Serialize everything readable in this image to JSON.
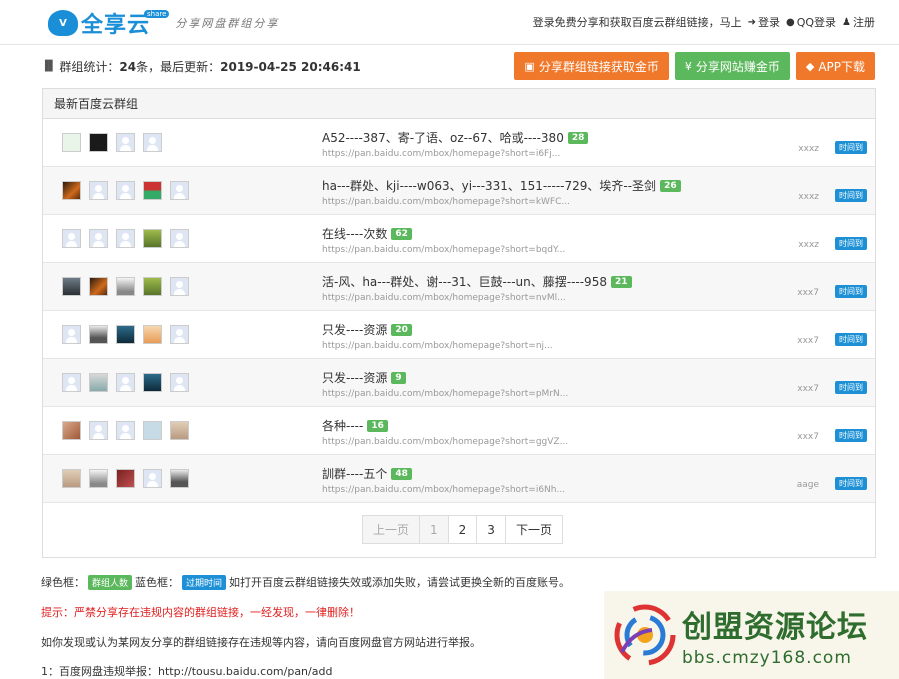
{
  "header": {
    "logo_mark": "V",
    "logo_name": "全享云",
    "logo_badge": "share",
    "slogan": "分享网盘群组分享",
    "nav_text": "登录免费分享和获取百度云群组链接，马上",
    "login": "登录",
    "qq_login": "QQ登录",
    "register": "注册"
  },
  "stats": {
    "label_prefix": "群组统计：",
    "count": "24",
    "label_mid": "条，最后更新：",
    "updated": "2019-04-25 20:46:41"
  },
  "actions": {
    "share_group": "分享群组链接获取金币",
    "share_site": "分享网站赚金币",
    "app_download": "APP下载"
  },
  "panel": {
    "title": "最新百度云群组",
    "rows": [
      {
        "title": "A52----387、寄-了语、oz--67、哈或----380",
        "count": "28",
        "link": "https://pan.baidu.com/mbox/homepage?short=i6Fj...",
        "user": "xxxz",
        "tag": "时间到"
      },
      {
        "title": "ha---群处、kji----w063、yi---331、151-----729、埃齐--圣剑",
        "count": "26",
        "link": "https://pan.baidu.com/mbox/homepage?short=kWFC...",
        "user": "xxxz",
        "tag": "时间到"
      },
      {
        "title": "在线----次数",
        "count": "62",
        "link": "https://pan.baidu.com/mbox/homepage?short=bqdY...",
        "user": "xxxz",
        "tag": "时间到"
      },
      {
        "title": "活-风、ha---群处、谢---31、巨鼓---un、藤摆----958",
        "count": "21",
        "link": "https://pan.baidu.com/mbox/homepage?short=nvMl...",
        "user": "xxx7",
        "tag": "时间到"
      },
      {
        "title": "只发----资源",
        "count": "20",
        "link": "https://pan.baidu.com/mbox/homepage?short=nj...",
        "user": "xxx7",
        "tag": "时间到"
      },
      {
        "title": "只发----资源",
        "count": "9",
        "link": "https://pan.baidu.com/mbox/homepage?short=pMrN...",
        "user": "xxx7",
        "tag": "时间到"
      },
      {
        "title": "各种----",
        "count": "16",
        "link": "https://pan.baidu.com/mbox/homepage?short=ggVZ...",
        "user": "xxx7",
        "tag": "时间到"
      },
      {
        "title": "訓群----五个",
        "count": "48",
        "link": "https://pan.baidu.com/mbox/homepage?short=i6Nh...",
        "user": "aage",
        "tag": "时间到"
      }
    ]
  },
  "pager": {
    "prev": "上一页",
    "p1": "1",
    "p2": "2",
    "p3": "3",
    "next": "下一页"
  },
  "notes": {
    "legend_green_label": "绿色框：",
    "legend_green_tag": "群组人数",
    "legend_blue_label": "蓝色框：",
    "legend_blue_tag": "过期时间",
    "legend_text": "如打开百度云群组链接失效或添加失败，请尝试更换全新的百度账号。",
    "warning": "提示：严禁分享存在违规内容的群组链接，一经发现，一律删除！",
    "report_text": "如你发现或认为某网友分享的群组链接存在违规等内容，请向百度网盘官方网站进行举报。",
    "report_link": "1：百度网盘违规举报：http://tousu.baidu.com/pan/add"
  },
  "watermark": {
    "title": "创盟资源论坛",
    "url": "bbs.cmzy168.com"
  },
  "colors": {
    "orange": "#f0782a",
    "green": "#5cb85c",
    "blue": "#1e90d6",
    "red": "#e02020"
  }
}
